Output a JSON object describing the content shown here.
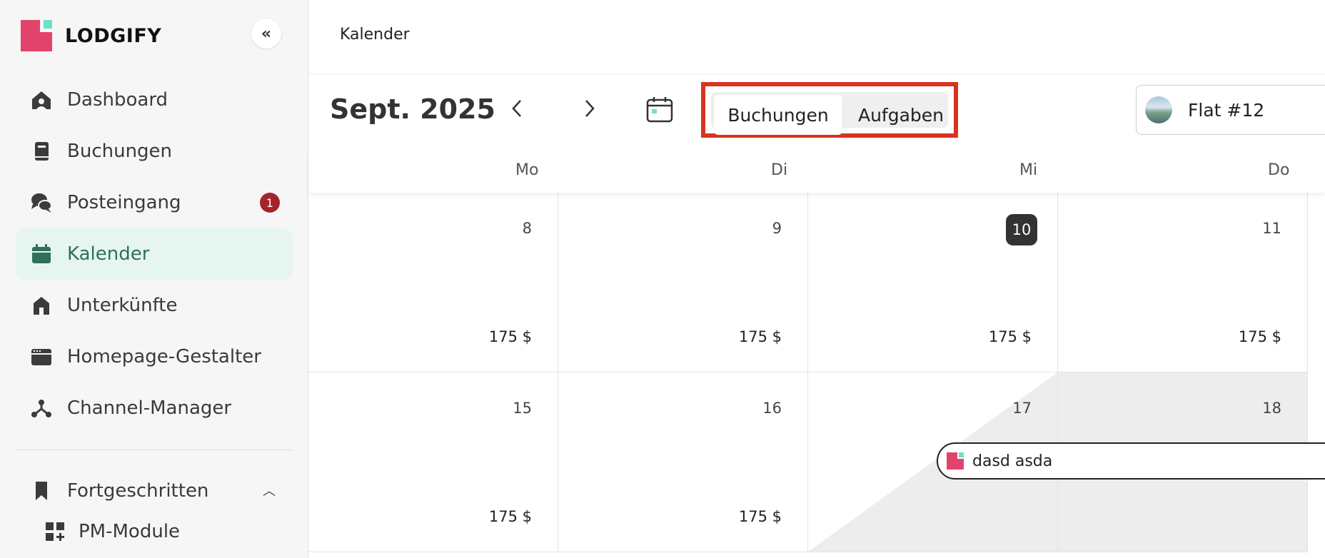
{
  "brand": {
    "name": "LODGIFY",
    "colors": {
      "pink": "#e2436b",
      "mint": "#6fe0c6"
    }
  },
  "sidebar": {
    "collapse_icon": "double-chevron-left-icon",
    "items": [
      {
        "label": "Dashboard",
        "icon": "home-icon"
      },
      {
        "label": "Buchungen",
        "icon": "book-icon"
      },
      {
        "label": "Posteingang",
        "icon": "chat-icon",
        "badge": "1"
      },
      {
        "label": "Kalender",
        "icon": "calendar-icon",
        "active": true
      },
      {
        "label": "Unterkünfte",
        "icon": "house-icon"
      },
      {
        "label": "Homepage-Gestalter",
        "icon": "browser-icon"
      },
      {
        "label": "Channel-Manager",
        "icon": "network-icon"
      }
    ],
    "advanced": {
      "label": "Fortgeschritten",
      "icon": "bookmark-icon",
      "expanded": true
    },
    "sub_items": [
      {
        "label": "PM-Module",
        "icon": "grid-plus-icon"
      }
    ]
  },
  "header": {
    "title": "Kalender"
  },
  "toolbar": {
    "month": "Sept. 2025",
    "view_toggle": {
      "selected": "Buchungen",
      "other": "Aufgaben"
    },
    "property": {
      "name": "Flat #12"
    }
  },
  "calendar": {
    "weekdays": [
      "Mo",
      "Di",
      "Mi",
      "Do"
    ],
    "weeks": [
      {
        "days": [
          {
            "day": "8",
            "price": "175 $"
          },
          {
            "day": "9",
            "price": "175 $"
          },
          {
            "day": "10",
            "price": "175 $",
            "today": true
          },
          {
            "day": "11",
            "price": "175 $"
          }
        ]
      },
      {
        "days": [
          {
            "day": "15",
            "price": "175 $"
          },
          {
            "day": "16",
            "price": "175 $"
          },
          {
            "day": "17"
          },
          {
            "day": "18"
          }
        ]
      }
    ],
    "booking": {
      "guest": "dasd asda"
    }
  }
}
